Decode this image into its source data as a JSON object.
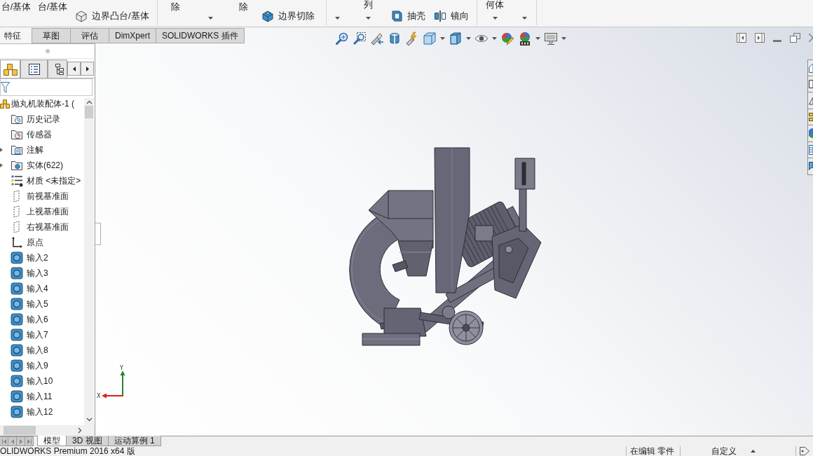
{
  "ribbon": {
    "groups": [
      {
        "columns": [
          {
            "kind": "big",
            "label": "台/基体"
          },
          {
            "kind": "big",
            "label": "台/基体"
          },
          {
            "kind": "small",
            "label": "边界凸台/基体"
          }
        ]
      },
      {
        "columns": [
          {
            "kind": "big",
            "label": "除"
          },
          {
            "kind": "dropdown"
          },
          {
            "kind": "big",
            "label": "除"
          },
          {
            "kind": "small",
            "label": "边界切除"
          }
        ]
      },
      {
        "columns": [
          {
            "kind": "dropdown"
          },
          {
            "kind": "split",
            "label": "列"
          },
          {
            "kind": "small",
            "label": "抽壳"
          },
          {
            "kind": "small",
            "label": "镜向"
          }
        ]
      },
      {
        "columns": [
          {
            "kind": "split",
            "label": "何体"
          },
          {
            "kind": "dropdown"
          }
        ]
      }
    ]
  },
  "command_tabs": [
    {
      "label": "特征",
      "selected": true
    },
    {
      "label": "草图",
      "selected": false
    },
    {
      "label": "评估",
      "selected": false
    },
    {
      "label": "DimXpert",
      "selected": false
    },
    {
      "label": "SOLIDWORKS 插件",
      "selected": false
    }
  ],
  "feature_manager": {
    "tabs": [
      {
        "kind": "features",
        "selected": true
      },
      {
        "kind": "properties",
        "selected": false
      },
      {
        "kind": "configurations",
        "selected": false
      }
    ],
    "tree": {
      "label": "抛丸机装配体-1 (",
      "kind": "assembly",
      "children": [
        {
          "label": "历史记录",
          "kind": "history",
          "expandable": false
        },
        {
          "label": "传感器",
          "kind": "sensors",
          "expandable": false
        },
        {
          "label": "注解",
          "kind": "annotations",
          "expandable": true
        },
        {
          "label": "实体(622)",
          "kind": "bodies",
          "expandable": true
        },
        {
          "label": "材质 <未指定>",
          "kind": "material",
          "expandable": false
        },
        {
          "label": "前视基准面",
          "kind": "plane",
          "expandable": false
        },
        {
          "label": "上视基准面",
          "kind": "plane",
          "expandable": false
        },
        {
          "label": "右视基准面",
          "kind": "plane",
          "expandable": false
        },
        {
          "label": "原点",
          "kind": "origin",
          "expandable": false
        },
        {
          "label": "输入2",
          "kind": "part",
          "expandable": false
        },
        {
          "label": "输入3",
          "kind": "part",
          "expandable": false
        },
        {
          "label": "输入4",
          "kind": "part",
          "expandable": false
        },
        {
          "label": "输入5",
          "kind": "part",
          "expandable": false
        },
        {
          "label": "输入6",
          "kind": "part",
          "expandable": false
        },
        {
          "label": "输入7",
          "kind": "part",
          "expandable": false
        },
        {
          "label": "输入8",
          "kind": "part",
          "expandable": false
        },
        {
          "label": "输入9",
          "kind": "part",
          "expandable": false
        },
        {
          "label": "输入10",
          "kind": "part",
          "expandable": false
        },
        {
          "label": "输入11",
          "kind": "part",
          "expandable": false
        },
        {
          "label": "输入12",
          "kind": "part",
          "expandable": false
        }
      ]
    }
  },
  "triad": {
    "x_label": "X",
    "y_label": "Y"
  },
  "model_tabs": [
    {
      "label": "模型",
      "selected": true
    },
    {
      "label": "3D 视图",
      "selected": false
    },
    {
      "label": "运动算例 1",
      "selected": false
    }
  ],
  "status_bar": {
    "product": "OLIDWORKS Premium 2016 x64 版",
    "mode": "在编辑 零件",
    "units": "自定义"
  }
}
